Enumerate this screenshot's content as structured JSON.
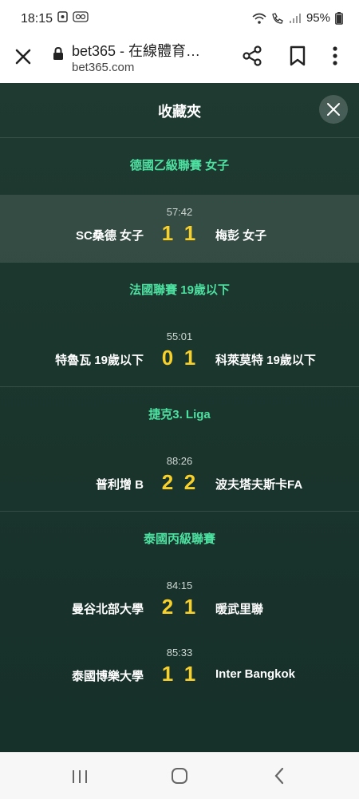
{
  "status_bar": {
    "time": "18:15",
    "battery": "95%",
    "icons": [
      "wifi-icon",
      "call-icon",
      "signal-icon",
      "battery-icon"
    ]
  },
  "browser": {
    "title": "bet365 - 在線體育…",
    "url": "bet365.com"
  },
  "favorites": {
    "title": "收藏夾",
    "sections": [
      {
        "league": "德國乙級聯賽 女子",
        "matches": [
          {
            "time": "57:42",
            "home": "SC桑德 女子",
            "home_score": "1",
            "away_score": "1",
            "away": "梅彭 女子"
          }
        ]
      },
      {
        "league": "法國聯賽 19歲以下",
        "matches": [
          {
            "time": "55:01",
            "home": "特魯瓦 19歲以下",
            "home_score": "0",
            "away_score": "1",
            "away": "科萊莫特 19歲以下"
          }
        ]
      },
      {
        "league": "捷克3. Liga",
        "matches": [
          {
            "time": "88:26",
            "home": "普利增 B",
            "home_score": "2",
            "away_score": "2",
            "away": "波夫塔夫斯卡FA"
          }
        ]
      },
      {
        "league": "泰國丙級聯賽",
        "matches": [
          {
            "time": "84:15",
            "home": "曼谷北部大學",
            "home_score": "2",
            "away_score": "1",
            "away": "暖武里聯"
          },
          {
            "time": "85:33",
            "home": "泰國博樂大學",
            "home_score": "1",
            "away_score": "1",
            "away": "Inter Bangkok"
          }
        ]
      }
    ]
  },
  "colors": {
    "background": "#1b362d",
    "league": "#4de0a1",
    "score": "#f8d02c"
  }
}
